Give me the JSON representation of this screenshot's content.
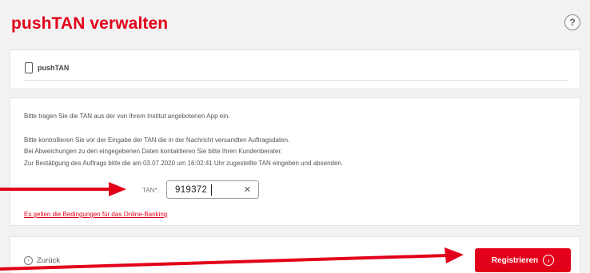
{
  "header": {
    "title": "pushTAN verwalten",
    "help_glyph": "?"
  },
  "method": {
    "label": "pushTAN",
    "icon": "smartphone-icon"
  },
  "instructions": {
    "line1": "Bitte tragen Sie die TAN aus der von Ihrem Institut angebotenen App ein.",
    "line2": "Bitte kontrollieren Sie vor der Eingabe der TAN die in der Nachricht versandten Auftragsdaten.",
    "line3": "Bei Abweichungen zu den eingegebenen Daten kontaktieren Sie bitte Ihren Kundenberater.",
    "line4": "Zur Bestätigung des Auftrags bitte die am 03.07.2020 um 16:02:41 Uhr zugestellte TAN eingeben und absenden."
  },
  "tan": {
    "label": "TAN*:",
    "value": "919372",
    "clear_glyph": "✕"
  },
  "conditions_link": "Es gelten die Bedingungen für das Online-Banking",
  "footer": {
    "back_label": "Zurück",
    "register_label": "Registrieren"
  },
  "colors": {
    "brand_red": "#e2001a",
    "annotation_red": "#e2001a"
  }
}
